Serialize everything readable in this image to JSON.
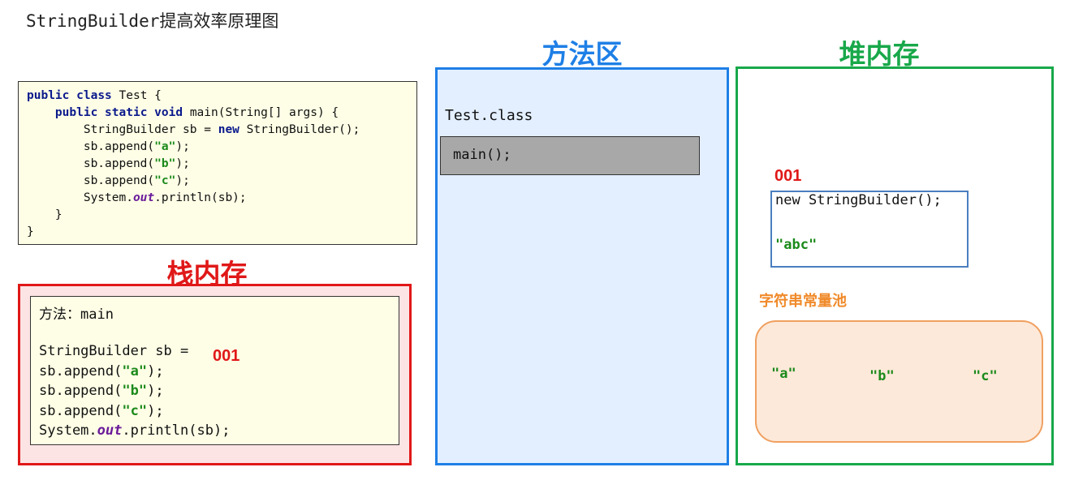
{
  "title": "StringBuilder提高效率原理图",
  "code": {
    "kw_public": "public",
    "kw_class": "class",
    "class_name": " Test {",
    "kw_static": "static",
    "kw_void": "void",
    "main_sig": " main(String[] args) {",
    "sb_decl": "StringBuilder sb = ",
    "kw_new": "new",
    "sb_ctor": " StringBuilder();",
    "append_open": "sb.append(",
    "append_close": ");",
    "str_a": "\"a\"",
    "str_b": "\"b\"",
    "str_c": "\"c\"",
    "system": "System.",
    "out": "out",
    "println": ".println(sb);",
    "close_inner": "}",
    "close_outer": "}"
  },
  "stack": {
    "title": "栈内存",
    "method_line": "方法：main",
    "sb_decl": "StringBuilder sb = ",
    "ref": "001",
    "append_open": "sb.append(",
    "append_close": ");",
    "str_a": "\"a\"",
    "str_b": "\"b\"",
    "str_c": "\"c\"",
    "system": "System.",
    "out": "out",
    "println": ".println(sb);"
  },
  "method_area": {
    "title": "方法区",
    "class_label": "Test.class",
    "main_block": "main();"
  },
  "heap": {
    "title": "堆内存",
    "object_address": "001",
    "object_ctor": "new StringBuilder();",
    "object_value": "\"abc\"",
    "pool_title": "字符串常量池",
    "pool_items": [
      "\"a\"",
      "\"b\"",
      "\"c\""
    ]
  },
  "colors": {
    "stack": "#e01818",
    "method_area": "#1e7fe6",
    "heap": "#18a84a",
    "pool": "#f08a2a",
    "string_literal": "#1b8a1b"
  }
}
